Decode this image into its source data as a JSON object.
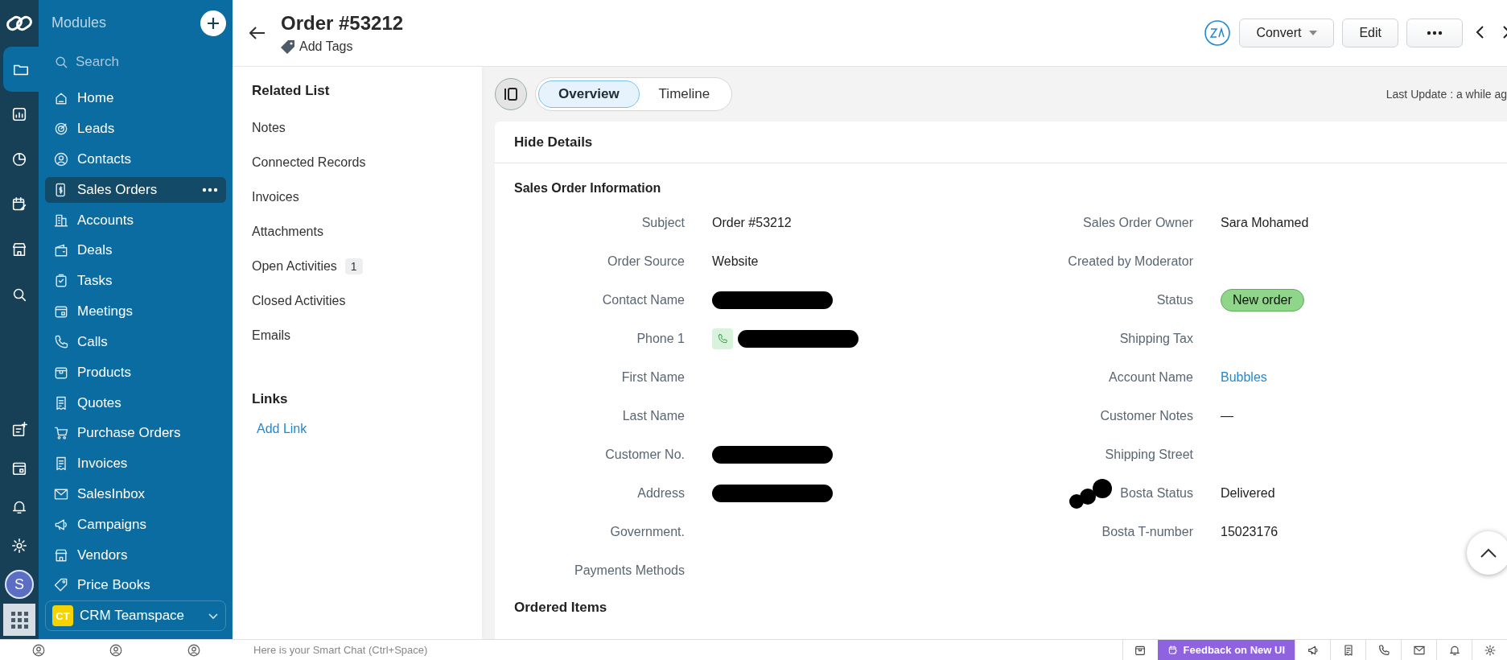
{
  "rail": {
    "top_items": [
      {
        "kind": "folder",
        "selected": true
      },
      {
        "kind": "report",
        "selected": false
      },
      {
        "kind": "pie",
        "selected": false
      },
      {
        "kind": "calendar-edit",
        "selected": false
      },
      {
        "kind": "store",
        "selected": false
      },
      {
        "kind": "search",
        "selected": false
      }
    ],
    "bottom_items": [
      {
        "kind": "note-add"
      },
      {
        "kind": "calendar"
      },
      {
        "kind": "bell"
      },
      {
        "kind": "gear"
      }
    ],
    "avatar": "S"
  },
  "modules": {
    "title": "Modules",
    "search": {
      "placeholder": "Search"
    },
    "items": [
      {
        "label": "Home",
        "kind": "home",
        "selected": false
      },
      {
        "label": "Leads",
        "kind": "target",
        "selected": false
      },
      {
        "label": "Contacts",
        "kind": "person",
        "selected": false
      },
      {
        "label": "Sales Orders",
        "kind": "money",
        "selected": true
      },
      {
        "label": "Accounts",
        "kind": "building",
        "selected": false
      },
      {
        "label": "Deals",
        "kind": "wallet",
        "selected": false
      },
      {
        "label": "Tasks",
        "kind": "task",
        "selected": false
      },
      {
        "label": "Meetings",
        "kind": "calendar",
        "selected": false
      },
      {
        "label": "Calls",
        "kind": "phone",
        "selected": false
      },
      {
        "label": "Products",
        "kind": "box",
        "selected": false
      },
      {
        "label": "Quotes",
        "kind": "doc",
        "selected": false
      },
      {
        "label": "Purchase Orders",
        "kind": "cart",
        "selected": false
      },
      {
        "label": "Invoices",
        "kind": "doc",
        "selected": false
      },
      {
        "label": "SalesInbox",
        "kind": "mail",
        "selected": false
      },
      {
        "label": "Campaigns",
        "kind": "megaphone",
        "selected": false
      },
      {
        "label": "Vendors",
        "kind": "store",
        "selected": false
      },
      {
        "label": "Price Books",
        "kind": "tag",
        "selected": false
      }
    ],
    "workspace": {
      "badge": "CT",
      "name": "CRM Teamspace"
    }
  },
  "header": {
    "title": "Order #53212",
    "add_tags": "Add Tags",
    "buttons": [
      {
        "label": "Convert",
        "kind": "dropdown"
      },
      {
        "label": "Edit",
        "kind": "plain"
      },
      {
        "kind": "more"
      }
    ]
  },
  "related_list": {
    "title": "Related List",
    "items": [
      {
        "label": "Notes"
      },
      {
        "label": "Connected Records"
      },
      {
        "label": "Invoices"
      },
      {
        "label": "Attachments"
      },
      {
        "label": "Open Activities",
        "count": "1"
      },
      {
        "label": "Closed Activities"
      },
      {
        "label": "Emails"
      }
    ],
    "links_title": "Links",
    "add_link": "Add Link"
  },
  "tabs": [
    {
      "label": "Overview",
      "selected": true
    },
    {
      "label": "Timeline",
      "selected": false
    }
  ],
  "last_update": "Last Update : a while ag",
  "details": {
    "toggle": "Hide Details",
    "section": "Sales Order Information",
    "left_fields": [
      {
        "label": "Subject",
        "value": "Order #53212",
        "kind": "text"
      },
      {
        "label": "Order Source",
        "value": "Website",
        "kind": "text"
      },
      {
        "label": "Contact Name",
        "kind": "text",
        "redacted": true
      },
      {
        "label": "Phone 1",
        "kind": "phone",
        "redacted": true
      },
      {
        "label": "First Name",
        "kind": "text"
      },
      {
        "label": "Last Name",
        "kind": "text"
      },
      {
        "label": "Customer No.",
        "kind": "text",
        "redacted": true
      },
      {
        "label": "Address",
        "kind": "text",
        "redacted": true
      },
      {
        "label": "Government.",
        "kind": "text"
      },
      {
        "label": "Payments Methods",
        "kind": "text"
      }
    ],
    "right_fields": [
      {
        "label": "Sales Order Owner",
        "value": "Sara Mohamed",
        "kind": "text"
      },
      {
        "label": "Created by Moderator",
        "kind": "text"
      },
      {
        "label": "Status",
        "value": "New order",
        "kind": "badge"
      },
      {
        "label": "Shipping Tax",
        "kind": "text"
      },
      {
        "label": "Account Name",
        "value": "Bubbles",
        "kind": "link"
      },
      {
        "label": "Customer Notes",
        "value": "—",
        "kind": "text"
      },
      {
        "label": "Shipping Street",
        "kind": "text"
      },
      {
        "label": "Bosta Status",
        "value": "Delivered",
        "kind": "text",
        "scribbled": true
      },
      {
        "label": "Bosta T-number",
        "value": "15023176",
        "kind": "text"
      }
    ],
    "ordered_items": "Ordered Items"
  },
  "bottom_bar": {
    "chat": {
      "placeholder": "Here is your Smart Chat (Ctrl+Space)"
    },
    "feedback": "Feedback on New UI"
  }
}
